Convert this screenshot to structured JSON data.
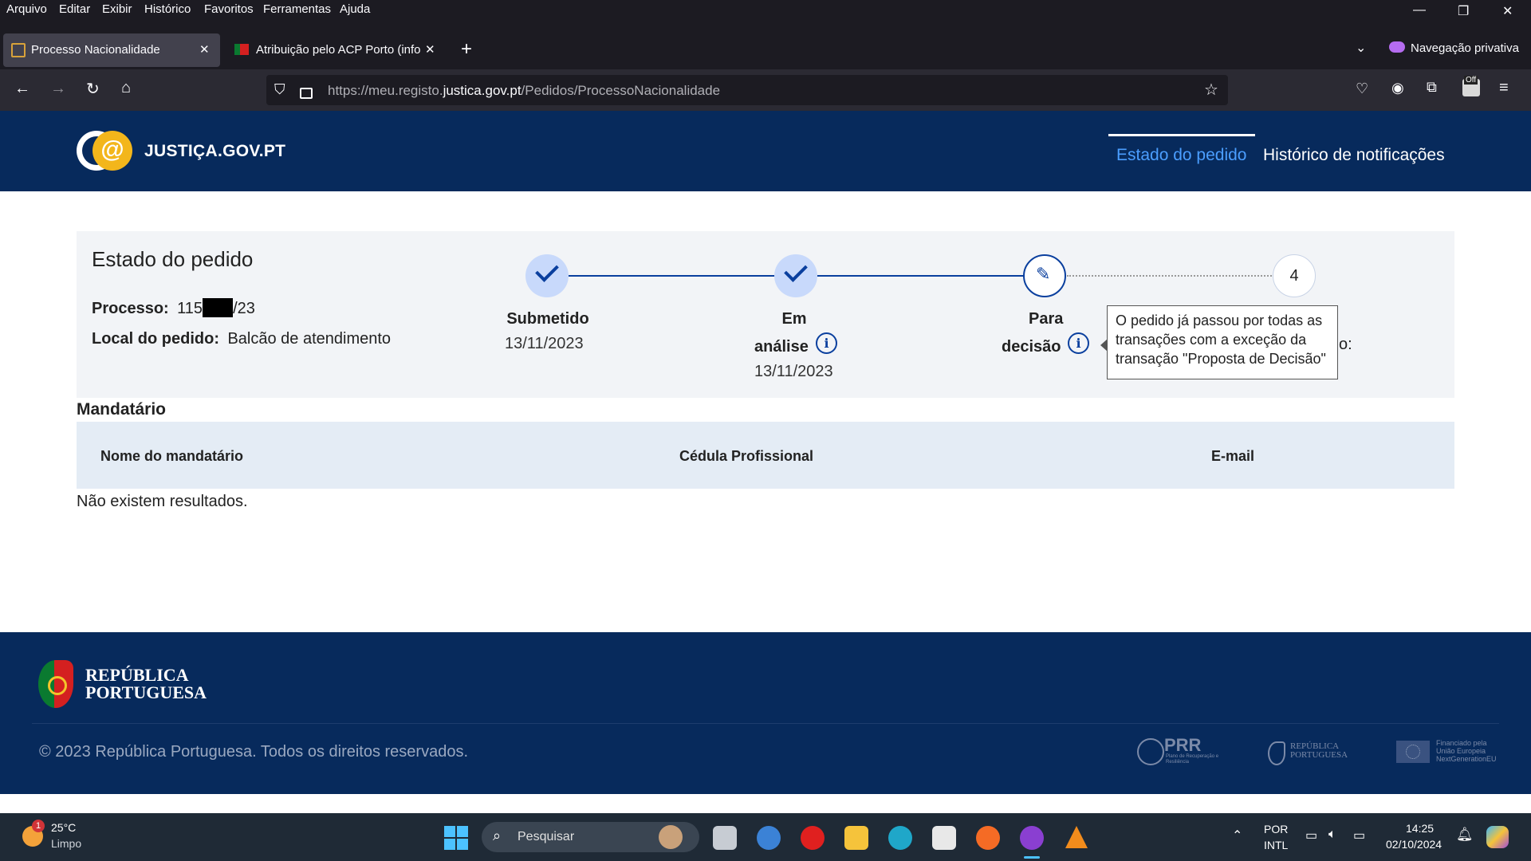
{
  "browser": {
    "menu": [
      "Arquivo",
      "Editar",
      "Exibir",
      "Histórico",
      "Favoritos",
      "Ferramentas",
      "Ajuda"
    ],
    "tabs": [
      {
        "label": "Processo Nacionalidade",
        "close": "✕"
      },
      {
        "label": "Atribuição pelo ACP Porto (info",
        "close": "✕"
      }
    ],
    "new_tab": "+",
    "private_label": "Navegação privativa",
    "url_prefix": "https://meu.registo.",
    "url_domain": "justica.gov.pt",
    "url_path": "/Pedidos/ProcessoNacionalidade",
    "extension_badge": "Off"
  },
  "site": {
    "logo_text": "JUSTIÇA.GOV.PT",
    "nav": {
      "estado": "Estado do pedido",
      "historico": "Histórico de notificações"
    }
  },
  "status": {
    "title": "Estado do pedido",
    "processo_label": "Processo:",
    "processo_prefix": "115",
    "processo_suffix": "/23",
    "local_label": "Local do pedido:",
    "local_value": "Balcão de atendimento",
    "steps": [
      {
        "label": "Submetido",
        "date": "13/11/2023"
      },
      {
        "label_line1": "Em",
        "label_line2": "análise",
        "date": "13/11/2023"
      },
      {
        "label_line1": "Para",
        "label_line2": "decisão"
      },
      {
        "number": "4",
        "partial_label": "o:"
      }
    ],
    "tooltip": "O pedido já passou por todas as transações com a exceção da transação \"Proposta de Decisão\""
  },
  "mandatario": {
    "title": "Mandatário",
    "columns": [
      "Nome do mandatário",
      "Cédula Profissional",
      "E-mail"
    ],
    "empty": "Não existem resultados."
  },
  "footer": {
    "rp_line1": "REPÚBLICA",
    "rp_line2": "PORTUGUESA",
    "copyright": "© 2023 República Portuguesa. Todos os direitos reservados.",
    "prr": "PRR",
    "prr_sub": "Plano de Recuperação e Resiliência",
    "rp_small1": "REPÚBLICA",
    "rp_small2": "PORTUGUESA",
    "eu1": "Financiado pela",
    "eu2": "União Europeia",
    "eu3": "NextGenerationEU"
  },
  "taskbar": {
    "temp": "25°C",
    "weather": "Limpo",
    "weather_badge": "1",
    "search": "Pesquisar",
    "lang1": "POR",
    "lang2": "INTL",
    "time": "14:25",
    "date": "02/10/2024"
  }
}
